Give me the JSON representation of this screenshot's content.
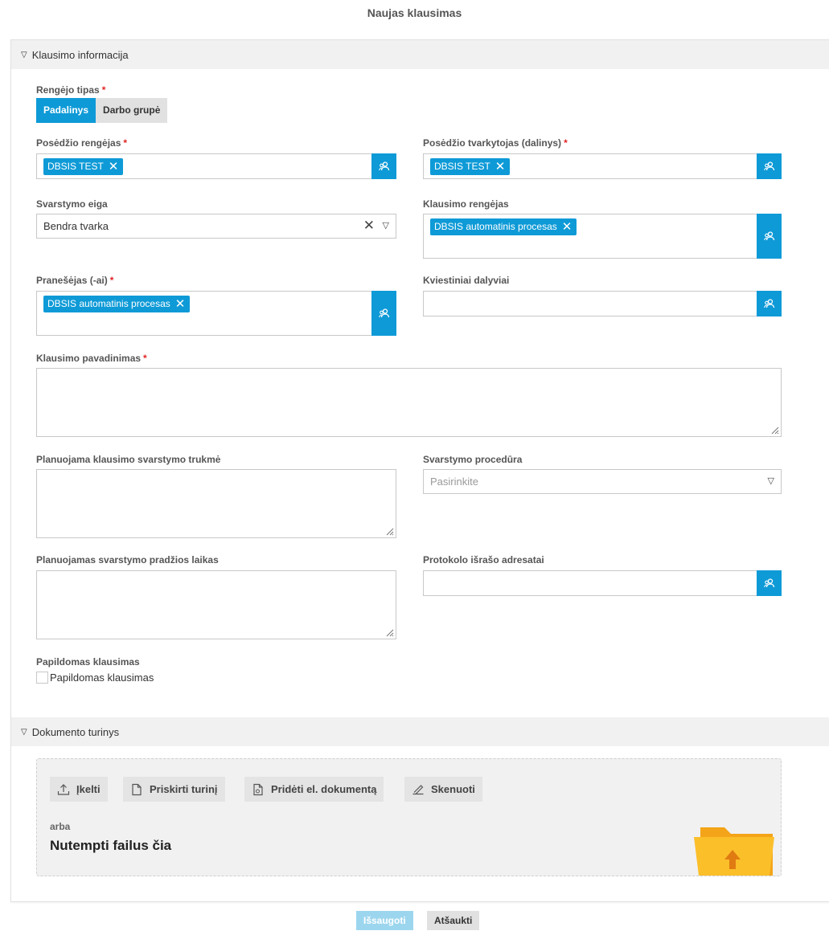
{
  "page": {
    "title": "Naujas klausimas"
  },
  "sections": {
    "info": "Klausimo informacija",
    "doc": "Dokumento turinys"
  },
  "renginys_tipas": {
    "label": "Rengėjo tipas",
    "options": [
      "Padalinys",
      "Darbo grupė"
    ],
    "selected": "Padalinys"
  },
  "fields": {
    "posedzio_rengejas": {
      "label": "Posėdžio rengėjas",
      "chip": "DBSIS TEST"
    },
    "posedzio_tvarkytojas": {
      "label": "Posėdžio tvarkytojas (dalinys)",
      "chip": "DBSIS TEST"
    },
    "svarstymo_eiga": {
      "label": "Svarstymo eiga",
      "value": "Bendra tvarka"
    },
    "klausimo_rengejas": {
      "label": "Klausimo rengėjas",
      "chip": "DBSIS automatinis procesas"
    },
    "pranesejas": {
      "label": "Pranešėjas (-ai)",
      "chip": "DBSIS automatinis procesas"
    },
    "kviestiniai": {
      "label": "Kviestiniai dalyviai"
    },
    "pavadinimas": {
      "label": "Klausimo pavadinimas"
    },
    "trukme": {
      "label": "Planuojama klausimo svarstymo trukmė"
    },
    "procedura": {
      "label": "Svarstymo procedūra",
      "placeholder": "Pasirinkite"
    },
    "pradzios_laikas": {
      "label": "Planuojamas svarstymo pradžios laikas"
    },
    "adresatai": {
      "label": "Protokolo išrašo adresatai"
    },
    "papildomas": {
      "label": "Papildomas klausimas",
      "checkbox_label": "Papildomas klausimas",
      "checked": false
    }
  },
  "required_mark": "*",
  "dropzone": {
    "buttons": {
      "upload": "Įkelti",
      "assign": "Priskirti turinį",
      "add_doc": "Pridėti el. dokumentą",
      "scan": "Skenuoti"
    },
    "or": "arba",
    "drop": "Nutempti failus čia"
  },
  "footer": {
    "save": "Išsaugoti",
    "cancel": "Atšaukti"
  },
  "colors": {
    "accent": "#0e9ad7",
    "required": "#e02424",
    "save_disabled": "#9cd6ee"
  }
}
